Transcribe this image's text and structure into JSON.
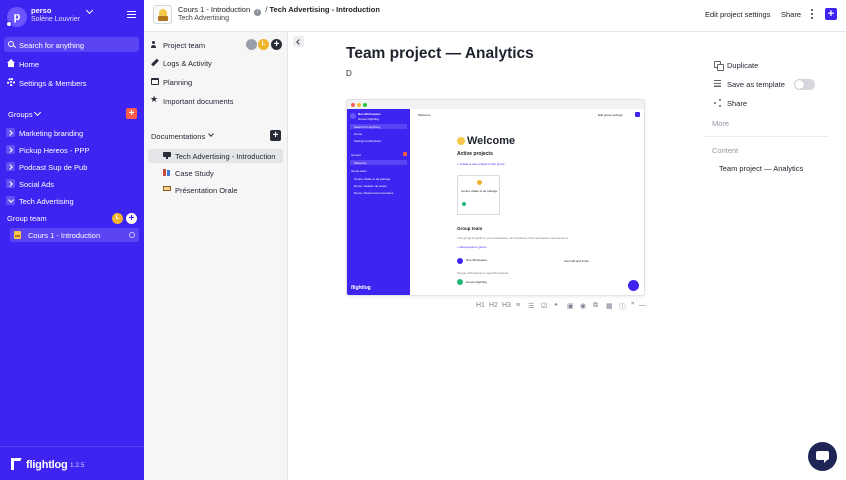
{
  "workspace": {
    "name": "perso",
    "user": "Solène Louvrier",
    "avatar_letter": "p"
  },
  "sidebar": {
    "search_label": "Search for anything",
    "nav": [
      {
        "label": "Home",
        "icon": "home-icon"
      },
      {
        "label": "Settings & Members",
        "icon": "gear-icon"
      }
    ],
    "groups_label": "Groups",
    "groups": [
      {
        "label": "Marketing branding"
      },
      {
        "label": "Pickup Hereos - PPP"
      },
      {
        "label": "Podcast Sup de Pub"
      },
      {
        "label": "Social Ads"
      },
      {
        "label": "Tech Advertising"
      }
    ],
    "group_team_label": "Group team",
    "group_team_avatar": "L",
    "active_course": "Cours 1 - Introduction",
    "brand": "flightlog",
    "version": "1.2.5"
  },
  "topbar": {
    "crumb_project": "Cours 1 - Introduction",
    "crumb_separator": "/",
    "crumb_doc": "Tech Advertising - Introduction",
    "subtitle": "Tech Advertising",
    "edit_label": "Edit project settings",
    "share_label": "Share",
    "add_label": "+"
  },
  "panel": {
    "items": [
      {
        "label": "Project team"
      },
      {
        "label": "Logs & Activity"
      },
      {
        "label": "Planning"
      },
      {
        "label": "Important documents"
      }
    ],
    "team_avatar": "L",
    "docs_label": "Documentations",
    "docs": [
      {
        "label": "Tech Advertising - Introduction"
      },
      {
        "label": "Case Study"
      },
      {
        "label": "Présentation Orale"
      }
    ]
  },
  "document": {
    "title": "Team project — Analytics",
    "body": "D",
    "screenshot": {
      "side_workspace": "Neo Workspace",
      "side_user": "Gnoss Flightlog",
      "side_search": "Search for anything",
      "side_home": "Home",
      "side_settings": "Settings & Members",
      "side_groups": "Groups",
      "side_welcome": "Welcome",
      "side_team": "Group team",
      "side_item1": "Centre d'aide et de partage",
      "side_item2": "Demo, Gestion de projet",
      "side_item3": "Demo, Ressources humaines",
      "side_brand": "flightlog",
      "top_crumb": "Welcome",
      "top_edit": "Edit group settings",
      "welcome": "Welcome",
      "active_projects": "Active projects",
      "create_link": "+ Create a new project in this group",
      "card_title": "Centre d'aide et de partage",
      "team_title": "Group team",
      "team_desc": "This group is public to your workspace. All members of the workspace can access it.",
      "add_people": "+ Add people to group",
      "member1": "Neo Workspace",
      "member1_role": "Can edit and invite",
      "access_label": "People with access to specific projects",
      "member2": "Gnoss Flightlog"
    },
    "toolbar": [
      "H1",
      "H2",
      "H3",
      "≡",
      "☰",
      "☑",
      "❝",
      "▣",
      "◉",
      "⧉",
      "▦",
      "ⓘ",
      "”",
      "—"
    ]
  },
  "right_panel": {
    "duplicate": "Duplicate",
    "save_template": "Save as template",
    "share": "Share",
    "more": "More",
    "content_label": "Content",
    "outline_item": "Team project — Analytics"
  },
  "colors": {
    "brand": "#3d24f0",
    "accent_red": "#ff5a4a",
    "avatar_yellow": "#f1b52c"
  }
}
